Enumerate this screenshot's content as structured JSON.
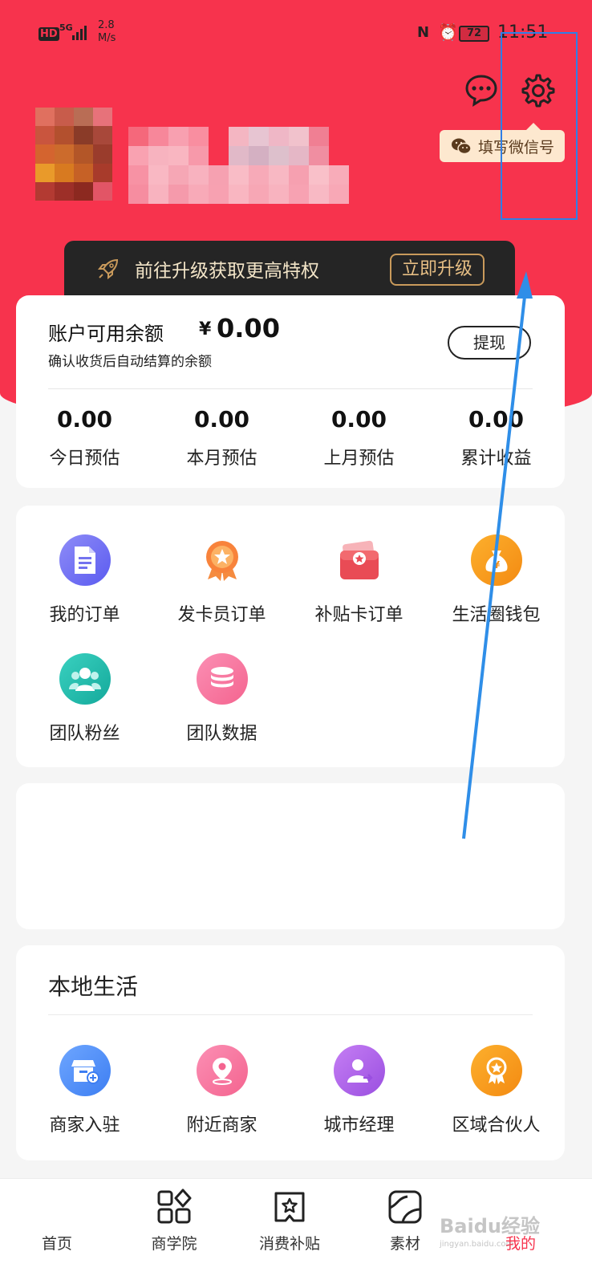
{
  "status_bar": {
    "hd": "HD",
    "network": "5G",
    "speed_value": "2.8",
    "speed_unit": "M/s",
    "battery": "72",
    "time": "11:51"
  },
  "header": {
    "message_icon": "chat-bubble-icon",
    "settings_icon": "gear-icon",
    "wechat_tag": "填写微信号",
    "accent_color": "#f7334d"
  },
  "upgrade": {
    "text": "前往升级获取更高特权",
    "button": "立即升级"
  },
  "balance": {
    "label": "账户可用余额",
    "currency": "¥",
    "value": "0.00",
    "subtitle": "确认收货后自动结算的余额",
    "withdraw": "提现",
    "stats": [
      {
        "value": "0.00",
        "label": "今日预估"
      },
      {
        "value": "0.00",
        "label": "本月预估"
      },
      {
        "value": "0.00",
        "label": "上月预估"
      },
      {
        "value": "0.00",
        "label": "累计收益"
      }
    ]
  },
  "features": [
    {
      "label": "我的订单",
      "icon": "document-icon"
    },
    {
      "label": "发卡员订单",
      "icon": "badge-icon"
    },
    {
      "label": "补贴卡订单",
      "icon": "wallet-card-icon"
    },
    {
      "label": "生活圈钱包",
      "icon": "money-bag-icon"
    },
    {
      "label": "团队粉丝",
      "icon": "team-icon"
    },
    {
      "label": "团队数据",
      "icon": "database-icon"
    }
  ],
  "local": {
    "title": "本地生活",
    "items": [
      {
        "label": "商家入驻",
        "icon": "store-add-icon"
      },
      {
        "label": "附近商家",
        "icon": "location-pin-icon"
      },
      {
        "label": "城市经理",
        "icon": "manager-icon"
      },
      {
        "label": "区域合伙人",
        "icon": "medal-icon"
      }
    ]
  },
  "tabs": [
    {
      "label": "首页",
      "icon": "home-icon"
    },
    {
      "label": "商学院",
      "icon": "apps-icon"
    },
    {
      "label": "消费补贴",
      "icon": "star-book-icon"
    },
    {
      "label": "素材",
      "icon": "material-icon"
    },
    {
      "label": "我的",
      "icon": "profile-icon",
      "active": true
    }
  ],
  "watermark": {
    "brand": "Baidu经验",
    "url": "jingyan.baidu.com"
  }
}
